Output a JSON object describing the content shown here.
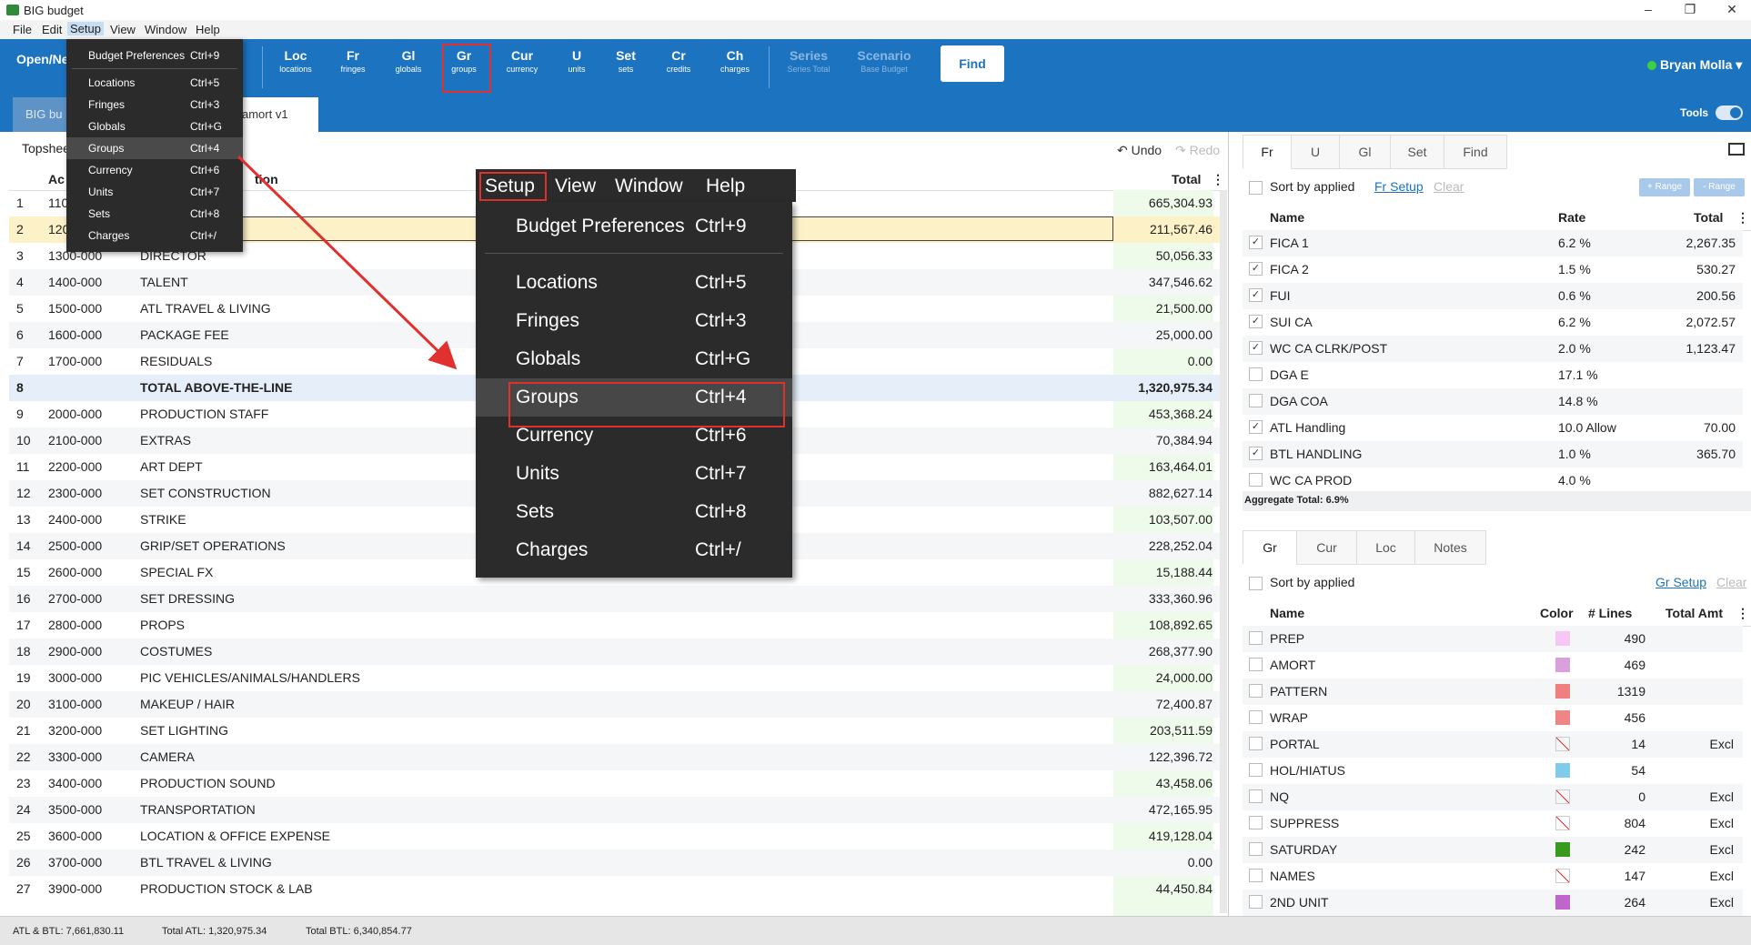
{
  "app": {
    "title": "BIG budget"
  },
  "menubar": [
    "File",
    "Edit",
    "Setup",
    "View",
    "Window",
    "Help"
  ],
  "toolbar": {
    "open_label": "Open/Ne",
    "buttons": [
      {
        "a": "Loc",
        "b": "locations"
      },
      {
        "a": "Fr",
        "b": "fringes"
      },
      {
        "a": "Gl",
        "b": "globals"
      },
      {
        "a": "Gr",
        "b": "groups"
      },
      {
        "a": "Cur",
        "b": "currency"
      },
      {
        "a": "U",
        "b": "units"
      },
      {
        "a": "Set",
        "b": "sets"
      },
      {
        "a": "Cr",
        "b": "credits"
      },
      {
        "a": "Ch",
        "b": "charges"
      },
      {
        "a": "Series",
        "b": "Series Total"
      },
      {
        "a": "Scenario",
        "b": "Base Budget"
      }
    ],
    "find_label": "Find",
    "user": "Bryan Molla",
    "user_caret": "▾"
  },
  "tabs": {
    "doc1": "BIG bu",
    "doc2": "amort v1",
    "tools": "Tools"
  },
  "left": {
    "topsheet": "Topshee",
    "undo": "Undo",
    "redo": "Redo",
    "col_acct": "Ac",
    "col_desc": "tion",
    "col_total": "Total",
    "rows": [
      {
        "n": "1",
        "acct": "110",
        "desc": "",
        "total": "665,304.93"
      },
      {
        "n": "2",
        "acct": "120",
        "desc": "",
        "total": "211,567.46"
      },
      {
        "n": "3",
        "acct": "1300-000",
        "desc": "DIRECTOR",
        "total": "50,056.33"
      },
      {
        "n": "4",
        "acct": "1400-000",
        "desc": "TALENT",
        "total": "347,546.62"
      },
      {
        "n": "5",
        "acct": "1500-000",
        "desc": "ATL TRAVEL & LIVING",
        "total": "21,500.00"
      },
      {
        "n": "6",
        "acct": "1600-000",
        "desc": "PACKAGE FEE",
        "total": "25,000.00"
      },
      {
        "n": "7",
        "acct": "1700-000",
        "desc": "RESIDUALS",
        "total": "0.00"
      },
      {
        "n": "8",
        "acct": "",
        "desc": "TOTAL ABOVE-THE-LINE",
        "total": "1,320,975.34"
      },
      {
        "n": "9",
        "acct": "2000-000",
        "desc": "PRODUCTION STAFF",
        "total": "453,368.24"
      },
      {
        "n": "10",
        "acct": "2100-000",
        "desc": "EXTRAS",
        "total": "70,384.94"
      },
      {
        "n": "11",
        "acct": "2200-000",
        "desc": "ART DEPT",
        "total": "163,464.01"
      },
      {
        "n": "12",
        "acct": "2300-000",
        "desc": "SET CONSTRUCTION",
        "total": "882,627.14"
      },
      {
        "n": "13",
        "acct": "2400-000",
        "desc": "STRIKE",
        "total": "103,507.00"
      },
      {
        "n": "14",
        "acct": "2500-000",
        "desc": "GRIP/SET OPERATIONS",
        "total": "228,252.04"
      },
      {
        "n": "15",
        "acct": "2600-000",
        "desc": "SPECIAL FX",
        "total": "15,188.44"
      },
      {
        "n": "16",
        "acct": "2700-000",
        "desc": "SET DRESSING",
        "total": "333,360.96"
      },
      {
        "n": "17",
        "acct": "2800-000",
        "desc": "PROPS",
        "total": "108,892.65"
      },
      {
        "n": "18",
        "acct": "2900-000",
        "desc": "COSTUMES",
        "total": "268,377.90"
      },
      {
        "n": "19",
        "acct": "3000-000",
        "desc": "PIC VEHICLES/ANIMALS/HANDLERS",
        "total": "24,000.00"
      },
      {
        "n": "20",
        "acct": "3100-000",
        "desc": "MAKEUP / HAIR",
        "total": "72,400.87"
      },
      {
        "n": "21",
        "acct": "3200-000",
        "desc": "SET LIGHTING",
        "total": "203,511.59"
      },
      {
        "n": "22",
        "acct": "3300-000",
        "desc": "CAMERA",
        "total": "122,396.72"
      },
      {
        "n": "23",
        "acct": "3400-000",
        "desc": "PRODUCTION SOUND",
        "total": "43,458.06"
      },
      {
        "n": "24",
        "acct": "3500-000",
        "desc": "TRANSPORTATION",
        "total": "472,165.95"
      },
      {
        "n": "25",
        "acct": "3600-000",
        "desc": "LOCATION & OFFICE EXPENSE",
        "total": "419,128.04"
      },
      {
        "n": "26",
        "acct": "3700-000",
        "desc": "BTL TRAVEL & LIVING",
        "total": "0.00"
      },
      {
        "n": "27",
        "acct": "3900-000",
        "desc": "PRODUCTION STOCK & LAB",
        "total": "44,450.84"
      }
    ]
  },
  "status": {
    "atl_btl": "ATL & BTL: 7,661,830.11",
    "total_atl": "Total ATL: 1,320,975.34",
    "total_btl": "Total BTL: 6,340,854.77"
  },
  "fringes": {
    "tabs": [
      "Fr",
      "U",
      "Gl",
      "Set",
      "Find"
    ],
    "sort_label": "Sort by applied",
    "setup_link": "Fr Setup",
    "clear_link": "Clear",
    "range_plus": "+ Range",
    "range_minus": "- Range",
    "col_name": "Name",
    "col_rate": "Rate",
    "col_total": "Total",
    "rows": [
      {
        "name": "FICA 1",
        "rate": "6.2 %",
        "total": "2,267.35",
        "checked": true
      },
      {
        "name": "FICA 2",
        "rate": "1.5 %",
        "total": "530.27",
        "checked": true
      },
      {
        "name": "FUI",
        "rate": "0.6 %",
        "total": "200.56",
        "checked": true
      },
      {
        "name": "SUI CA",
        "rate": "6.2 %",
        "total": "2,072.57",
        "checked": true
      },
      {
        "name": "WC CA CLRK/POST",
        "rate": "2.0 %",
        "total": "1,123.47",
        "checked": true
      },
      {
        "name": "DGA E",
        "rate": "17.1 %",
        "total": "",
        "checked": false
      },
      {
        "name": "DGA COA",
        "rate": "14.8 %",
        "total": "",
        "checked": false
      },
      {
        "name": "ATL Handling",
        "rate": "10.0 Allow",
        "total": "70.00",
        "checked": true
      },
      {
        "name": "BTL HANDLING",
        "rate": "1.0 %",
        "total": "365.70",
        "checked": true
      },
      {
        "name": "WC CA PROD",
        "rate": "4.0 %",
        "total": "",
        "checked": false
      }
    ],
    "aggregate": "Aggregate Total: 6.9%"
  },
  "groups": {
    "tabs": [
      "Gr",
      "Cur",
      "Loc",
      "Notes"
    ],
    "sort_label": "Sort by applied",
    "setup_link": "Gr Setup",
    "clear_link": "Clear",
    "col_name": "Name",
    "col_color": "Color",
    "col_lines": "# Lines",
    "col_amt": "Total Amt",
    "rows": [
      {
        "name": "PREP",
        "color": "#f7c6f5",
        "lines": "490",
        "amt": ""
      },
      {
        "name": "AMORT",
        "color": "#d9a0dc",
        "lines": "469",
        "amt": ""
      },
      {
        "name": "PATTERN",
        "color": "#f07f7f",
        "lines": "1319",
        "amt": ""
      },
      {
        "name": "WRAP",
        "color": "#ef8585",
        "lines": "456",
        "amt": ""
      },
      {
        "name": "PORTAL",
        "color": "none",
        "lines": "14",
        "amt": "Excl"
      },
      {
        "name": "HOL/HIATUS",
        "color": "#7ecbea",
        "lines": "54",
        "amt": ""
      },
      {
        "name": "NQ",
        "color": "none",
        "lines": "0",
        "amt": "Excl"
      },
      {
        "name": "SUPPRESS",
        "color": "none",
        "lines": "804",
        "amt": "Excl"
      },
      {
        "name": "SATURDAY",
        "color": "#3a9a1e",
        "lines": "242",
        "amt": "Excl"
      },
      {
        "name": "NAMES",
        "color": "none",
        "lines": "147",
        "amt": "Excl"
      },
      {
        "name": "2ND UNIT",
        "color": "#c065c9",
        "lines": "264",
        "amt": "Excl"
      }
    ]
  },
  "setup_menu": {
    "items": [
      {
        "label": "Budget Preferences",
        "shortcut": "Ctrl+9"
      },
      {
        "label": "Locations",
        "shortcut": "Ctrl+5"
      },
      {
        "label": "Fringes",
        "shortcut": "Ctrl+3"
      },
      {
        "label": "Globals",
        "shortcut": "Ctrl+G"
      },
      {
        "label": "Groups",
        "shortcut": "Ctrl+4"
      },
      {
        "label": "Currency",
        "shortcut": "Ctrl+6"
      },
      {
        "label": "Units",
        "shortcut": "Ctrl+7"
      },
      {
        "label": "Sets",
        "shortcut": "Ctrl+8"
      },
      {
        "label": "Charges",
        "shortcut": "Ctrl+/"
      }
    ]
  },
  "zoom_menubar": [
    "Setup",
    "View",
    "Window",
    "Help"
  ],
  "colors": {
    "toolbar": "#1c73c0",
    "highlight_box": "#e03030",
    "arrow": "#e03030"
  }
}
